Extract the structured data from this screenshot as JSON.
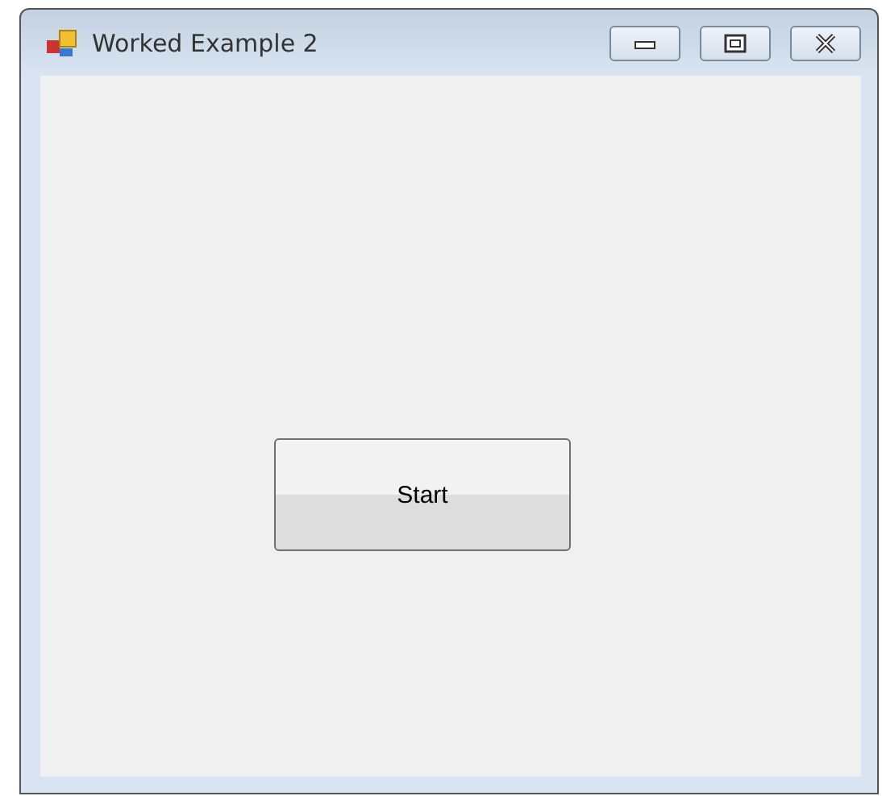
{
  "window": {
    "title": "Worked Example 2"
  },
  "buttons": [
    {
      "label": "Start"
    }
  ]
}
